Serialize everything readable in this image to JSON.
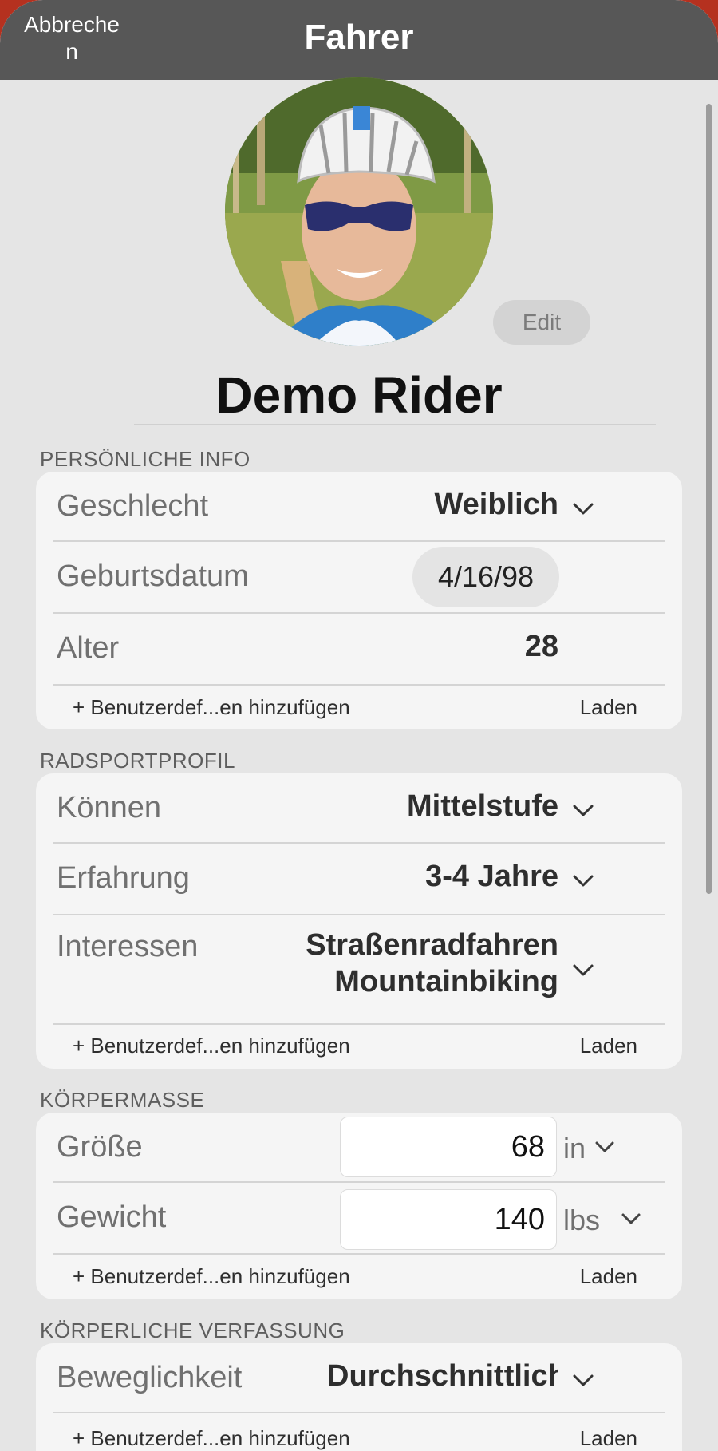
{
  "nav": {
    "cancel_label": "Abbrechen",
    "title": "Fahrer"
  },
  "profile": {
    "edit_label": "Edit",
    "name": "Demo Rider"
  },
  "sections": {
    "personal": {
      "header": "PERSÖNLICHE INFO",
      "gender_label": "Geschlecht",
      "gender_value": "Weiblich",
      "birthdate_label": "Geburtsdatum",
      "birthdate_value": "4/16/98",
      "age_label": "Alter",
      "age_value": "28",
      "add_custom": "+ Benutzerdef...en hinzufügen",
      "load": "Laden"
    },
    "cycling": {
      "header": "RADSPORTPROFIL",
      "skill_label": "Können",
      "skill_value": "Mittelstufe",
      "experience_label": "Erfahrung",
      "experience_value": "3-4 Jahre",
      "interests_label": "Interessen",
      "interests_value_1": "Straßenradfahren",
      "interests_value_2": "Mountainbiking",
      "add_custom": "+ Benutzerdef...en hinzufügen",
      "load": "Laden"
    },
    "body": {
      "header": "KÖRPERMASSE",
      "height_label": "Größe",
      "height_value": "68",
      "height_unit": "in",
      "weight_label": "Gewicht",
      "weight_value": "140",
      "weight_unit": "lbs",
      "add_custom": "+ Benutzerdef...en hinzufügen",
      "load": "Laden"
    },
    "physical": {
      "header": "KÖRPERLICHE VERFASSUNG",
      "flexibility_label": "Beweglichkeit",
      "flexibility_value": "Durchschnittlich",
      "add_custom": "+ Benutzerdef...en hinzufügen",
      "load": "Laden"
    }
  },
  "icons": {
    "dropdown": "chevron-down-icon",
    "avatar": "rider-photo"
  },
  "colors": {
    "nav_bg": "#575757",
    "page_bg": "#e5e5e5",
    "card_bg": "#f5f5f5",
    "outer_bg": "#b5311f"
  }
}
